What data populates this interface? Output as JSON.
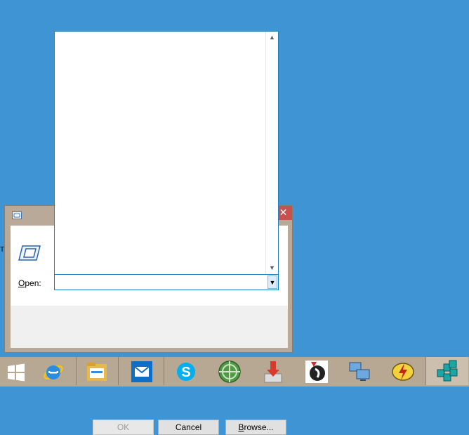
{
  "desktop": {
    "background": "#3f94d3",
    "edge_text": "T"
  },
  "run_dialog": {
    "close_glyph": "✕",
    "open_label_underlined": "O",
    "open_label_rest": "pen:",
    "open_value": "",
    "ok_label": "OK",
    "cancel_label": "Cancel",
    "browse_label_underlined": "B",
    "browse_label_rest": "rowse...",
    "icon": "run-app-icon"
  },
  "dropdown": {
    "items": [],
    "scroll_up_glyph": "▲",
    "scroll_down_glyph": "▼",
    "combo_arrow_glyph": "▼"
  },
  "taskbar": {
    "items": [
      "windows-start-icon",
      "internet-explorer-icon",
      "file-explorer-icon",
      "mail-icon",
      "skype-icon",
      "network-globe-icon",
      "download-manager-icon",
      "media-player-icon",
      "remote-desktop-icon",
      "flash-tool-icon",
      "registry-cubes-icon"
    ],
    "colors": {
      "accent_blue": "#0f6fc6",
      "skype_blue": "#00aff0"
    }
  }
}
